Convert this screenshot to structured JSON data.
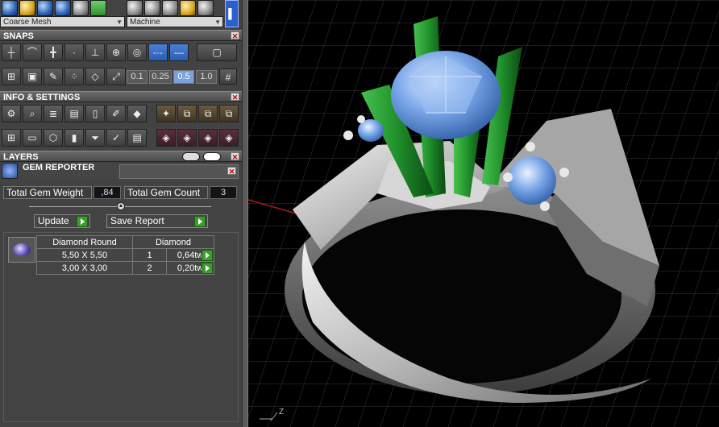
{
  "toolbar": {
    "icons_left": [
      "grid-icon",
      "shield-icon",
      "sphere-blue-icon",
      "sphere-blue-icon",
      "settings-icon",
      "green-grid-icon"
    ],
    "icons_right": [
      "sphere-grey-icon",
      "sphere-grey-icon",
      "sphere-grey-icon",
      "gold-ring-icon",
      "sphere-grey-icon"
    ],
    "mesh_dropdown": "Coarse Mesh",
    "material_dropdown": "Machine"
  },
  "sections": {
    "snaps": "SNAPS",
    "info_settings": "INFO & SETTINGS",
    "layers": "LAYERS"
  },
  "snap_values": [
    "0.1",
    "0.25",
    "0.5",
    "1.0"
  ],
  "snap_selected": "0.5",
  "gem_reporter": {
    "title": "GEM REPORTER",
    "total_weight_label": "Total Gem Weight",
    "total_weight_value": ",84",
    "total_count_label": "Total Gem Count",
    "total_count_value": "3",
    "update_label": "Update",
    "save_label": "Save Report",
    "table": {
      "header": [
        "Diamond Round",
        "Diamond"
      ],
      "rows": [
        {
          "size": "5,50 X 5,50",
          "count": "1",
          "weight": "0,64tw"
        },
        {
          "size": "3,00 X 3,00",
          "count": "2",
          "weight": "0,20tw"
        }
      ]
    }
  },
  "viewport": {
    "axis_label": "Z",
    "colors": {
      "prongs": "#1f8f2a",
      "gem": "#7aa6e8",
      "metal": "#bdbdbd",
      "grid": "#3a3a3a",
      "axis_x": "#c02020"
    }
  }
}
